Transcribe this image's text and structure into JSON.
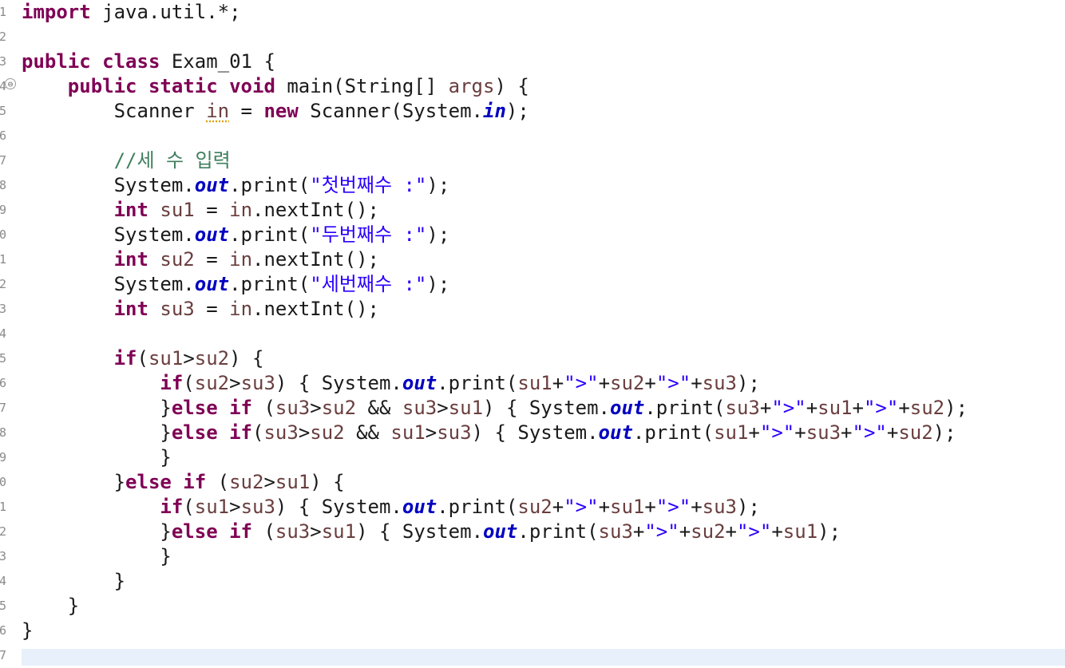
{
  "editor": {
    "line_numbers": [
      "1",
      "2",
      "3",
      "4",
      "5",
      "6",
      "7",
      "8",
      "9",
      "0",
      "1",
      "2",
      "3",
      "4",
      "5",
      "6",
      "7",
      "8",
      "9",
      "0",
      "1",
      "2",
      "3",
      "4",
      "5",
      "6",
      "7"
    ],
    "fold_marker": "⊖",
    "lines": [
      [
        {
          "t": "import",
          "c": "kw"
        },
        {
          "t": " java.util.*;"
        }
      ],
      [],
      [
        {
          "t": "public",
          "c": "kw"
        },
        {
          "t": " "
        },
        {
          "t": "class",
          "c": "kw"
        },
        {
          "t": " Exam_01 {"
        }
      ],
      [
        {
          "t": "    "
        },
        {
          "t": "public",
          "c": "kw"
        },
        {
          "t": " "
        },
        {
          "t": "static",
          "c": "kw"
        },
        {
          "t": " "
        },
        {
          "t": "void",
          "c": "kw"
        },
        {
          "t": " main(String[] "
        },
        {
          "t": "args",
          "c": "var"
        },
        {
          "t": ") {"
        }
      ],
      [
        {
          "t": "        Scanner "
        },
        {
          "t": "in",
          "c": "var warn"
        },
        {
          "t": " = "
        },
        {
          "t": "new",
          "c": "kw"
        },
        {
          "t": " Scanner(System."
        },
        {
          "t": "in",
          "c": "fld"
        },
        {
          "t": ");"
        }
      ],
      [],
      [
        {
          "t": "        "
        },
        {
          "t": "//세 수 입력",
          "c": "cm"
        }
      ],
      [
        {
          "t": "        System."
        },
        {
          "t": "out",
          "c": "fld"
        },
        {
          "t": ".print("
        },
        {
          "t": "\"첫번째수 :\"",
          "c": "str"
        },
        {
          "t": ");"
        }
      ],
      [
        {
          "t": "        "
        },
        {
          "t": "int",
          "c": "kw"
        },
        {
          "t": " "
        },
        {
          "t": "su1",
          "c": "var"
        },
        {
          "t": " = "
        },
        {
          "t": "in",
          "c": "var"
        },
        {
          "t": ".nextInt();"
        }
      ],
      [
        {
          "t": "        System."
        },
        {
          "t": "out",
          "c": "fld"
        },
        {
          "t": ".print("
        },
        {
          "t": "\"두번째수 :\"",
          "c": "str"
        },
        {
          "t": ");"
        }
      ],
      [
        {
          "t": "        "
        },
        {
          "t": "int",
          "c": "kw"
        },
        {
          "t": " "
        },
        {
          "t": "su2",
          "c": "var"
        },
        {
          "t": " = "
        },
        {
          "t": "in",
          "c": "var"
        },
        {
          "t": ".nextInt();"
        }
      ],
      [
        {
          "t": "        System."
        },
        {
          "t": "out",
          "c": "fld"
        },
        {
          "t": ".print("
        },
        {
          "t": "\"세번째수 :\"",
          "c": "str"
        },
        {
          "t": ");"
        }
      ],
      [
        {
          "t": "        "
        },
        {
          "t": "int",
          "c": "kw"
        },
        {
          "t": " "
        },
        {
          "t": "su3",
          "c": "var"
        },
        {
          "t": " = "
        },
        {
          "t": "in",
          "c": "var"
        },
        {
          "t": ".nextInt();"
        }
      ],
      [],
      [
        {
          "t": "        "
        },
        {
          "t": "if",
          "c": "kw"
        },
        {
          "t": "("
        },
        {
          "t": "su1",
          "c": "var"
        },
        {
          "t": ">"
        },
        {
          "t": "su2",
          "c": "var"
        },
        {
          "t": ") {"
        }
      ],
      [
        {
          "t": "            "
        },
        {
          "t": "if",
          "c": "kw"
        },
        {
          "t": "("
        },
        {
          "t": "su2",
          "c": "var"
        },
        {
          "t": ">"
        },
        {
          "t": "su3",
          "c": "var"
        },
        {
          "t": ") { System."
        },
        {
          "t": "out",
          "c": "fld"
        },
        {
          "t": ".print("
        },
        {
          "t": "su1",
          "c": "var"
        },
        {
          "t": "+"
        },
        {
          "t": "\">\"",
          "c": "str"
        },
        {
          "t": "+"
        },
        {
          "t": "su2",
          "c": "var"
        },
        {
          "t": "+"
        },
        {
          "t": "\">\"",
          "c": "str"
        },
        {
          "t": "+"
        },
        {
          "t": "su3",
          "c": "var"
        },
        {
          "t": ");"
        }
      ],
      [
        {
          "t": "            }"
        },
        {
          "t": "else",
          "c": "kw"
        },
        {
          "t": " "
        },
        {
          "t": "if",
          "c": "kw"
        },
        {
          "t": " ("
        },
        {
          "t": "su3",
          "c": "var"
        },
        {
          "t": ">"
        },
        {
          "t": "su2",
          "c": "var"
        },
        {
          "t": " && "
        },
        {
          "t": "su3",
          "c": "var"
        },
        {
          "t": ">"
        },
        {
          "t": "su1",
          "c": "var"
        },
        {
          "t": ") { System."
        },
        {
          "t": "out",
          "c": "fld"
        },
        {
          "t": ".print("
        },
        {
          "t": "su3",
          "c": "var"
        },
        {
          "t": "+"
        },
        {
          "t": "\">\"",
          "c": "str"
        },
        {
          "t": "+"
        },
        {
          "t": "su1",
          "c": "var"
        },
        {
          "t": "+"
        },
        {
          "t": "\">\"",
          "c": "str"
        },
        {
          "t": "+"
        },
        {
          "t": "su2",
          "c": "var"
        },
        {
          "t": ");"
        }
      ],
      [
        {
          "t": "            }"
        },
        {
          "t": "else",
          "c": "kw"
        },
        {
          "t": " "
        },
        {
          "t": "if",
          "c": "kw"
        },
        {
          "t": "("
        },
        {
          "t": "su3",
          "c": "var"
        },
        {
          "t": ">"
        },
        {
          "t": "su2",
          "c": "var"
        },
        {
          "t": " && "
        },
        {
          "t": "su1",
          "c": "var"
        },
        {
          "t": ">"
        },
        {
          "t": "su3",
          "c": "var"
        },
        {
          "t": ") { System."
        },
        {
          "t": "out",
          "c": "fld"
        },
        {
          "t": ".print("
        },
        {
          "t": "su1",
          "c": "var"
        },
        {
          "t": "+"
        },
        {
          "t": "\">\"",
          "c": "str"
        },
        {
          "t": "+"
        },
        {
          "t": "su3",
          "c": "var"
        },
        {
          "t": "+"
        },
        {
          "t": "\">\"",
          "c": "str"
        },
        {
          "t": "+"
        },
        {
          "t": "su2",
          "c": "var"
        },
        {
          "t": ");"
        }
      ],
      [
        {
          "t": "            }"
        }
      ],
      [
        {
          "t": "        }"
        },
        {
          "t": "else",
          "c": "kw"
        },
        {
          "t": " "
        },
        {
          "t": "if",
          "c": "kw"
        },
        {
          "t": " ("
        },
        {
          "t": "su2",
          "c": "var"
        },
        {
          "t": ">"
        },
        {
          "t": "su1",
          "c": "var"
        },
        {
          "t": ") {"
        }
      ],
      [
        {
          "t": "            "
        },
        {
          "t": "if",
          "c": "kw"
        },
        {
          "t": "("
        },
        {
          "t": "su1",
          "c": "var"
        },
        {
          "t": ">"
        },
        {
          "t": "su3",
          "c": "var"
        },
        {
          "t": ") { System."
        },
        {
          "t": "out",
          "c": "fld"
        },
        {
          "t": ".print("
        },
        {
          "t": "su2",
          "c": "var"
        },
        {
          "t": "+"
        },
        {
          "t": "\">\"",
          "c": "str"
        },
        {
          "t": "+"
        },
        {
          "t": "su1",
          "c": "var"
        },
        {
          "t": "+"
        },
        {
          "t": "\">\"",
          "c": "str"
        },
        {
          "t": "+"
        },
        {
          "t": "su3",
          "c": "var"
        },
        {
          "t": ");"
        }
      ],
      [
        {
          "t": "            }"
        },
        {
          "t": "else",
          "c": "kw"
        },
        {
          "t": " "
        },
        {
          "t": "if",
          "c": "kw"
        },
        {
          "t": " ("
        },
        {
          "t": "su3",
          "c": "var"
        },
        {
          "t": ">"
        },
        {
          "t": "su1",
          "c": "var"
        },
        {
          "t": ") { System."
        },
        {
          "t": "out",
          "c": "fld"
        },
        {
          "t": ".print("
        },
        {
          "t": "su3",
          "c": "var"
        },
        {
          "t": "+"
        },
        {
          "t": "\">\"",
          "c": "str"
        },
        {
          "t": "+"
        },
        {
          "t": "su2",
          "c": "var"
        },
        {
          "t": "+"
        },
        {
          "t": "\">\"",
          "c": "str"
        },
        {
          "t": "+"
        },
        {
          "t": "su1",
          "c": "var"
        },
        {
          "t": ");"
        }
      ],
      [
        {
          "t": "            }"
        }
      ],
      [
        {
          "t": "        }"
        }
      ],
      [
        {
          "t": "    }"
        }
      ],
      [
        {
          "t": "}"
        }
      ],
      []
    ]
  }
}
